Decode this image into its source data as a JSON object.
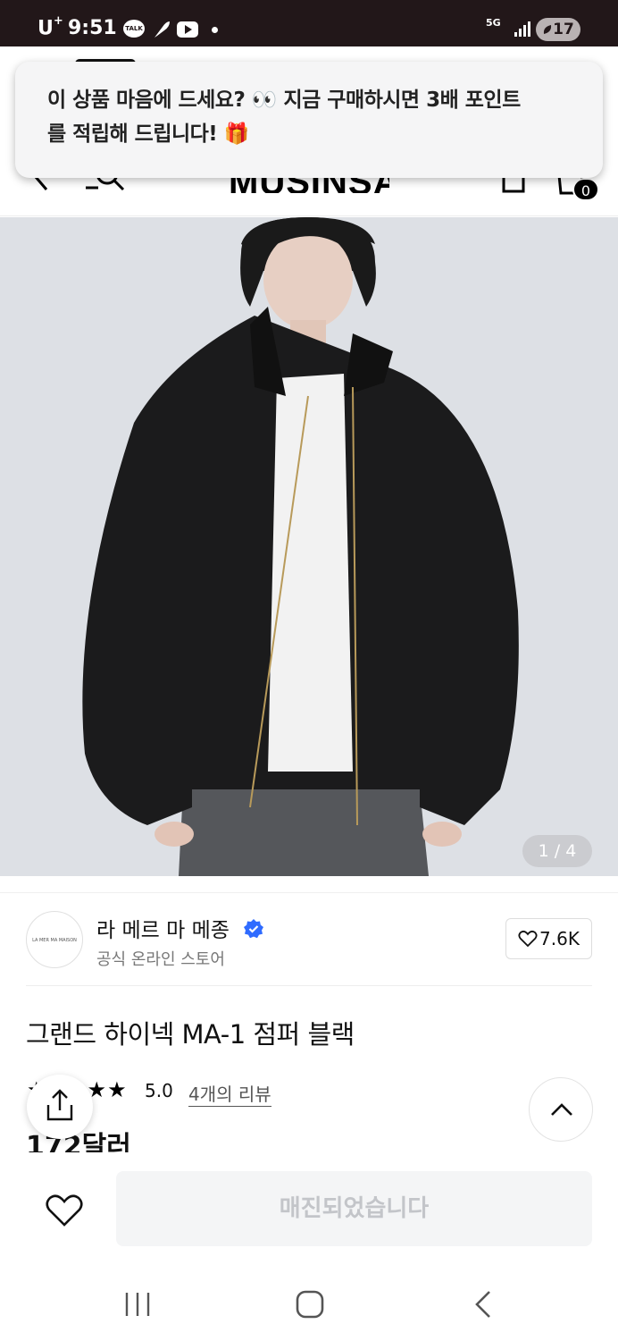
{
  "status_bar": {
    "carrier": "U",
    "carrier_sup": "+",
    "time": "9:51",
    "talk_icon_text": "TALK",
    "network": "5G",
    "battery": "17"
  },
  "header": {
    "logo": "MUSINSA",
    "cart_count": "0"
  },
  "toast": {
    "line1": "이 상품 마음에 드세요? 👀 지금 구매하시면 3배 포인트",
    "line2": "를 적립해 드립니다! 🎁"
  },
  "gallery": {
    "counter": "1 / 4"
  },
  "brand": {
    "logo_text": "LA MER MA MAISON",
    "name": "라 메르 마 메종",
    "subtitle": "공식 온라인 스토어",
    "like_count": "7.6K"
  },
  "product": {
    "title": "그랜드 하이넥 MA-1 점퍼 블랙",
    "stars": "★★★★★",
    "rating": "5.0",
    "review_link": "4개의 리뷰",
    "price": "172달러"
  },
  "bottom_bar": {
    "soldout_label": "매진되었습니다"
  },
  "colors": {
    "status_bar_bg": "#221719",
    "image_bg": "#dde0e5",
    "verified_blue": "#2f6bff",
    "soldout_bg": "#f4f5f6",
    "soldout_text": "#c3c5c9"
  }
}
